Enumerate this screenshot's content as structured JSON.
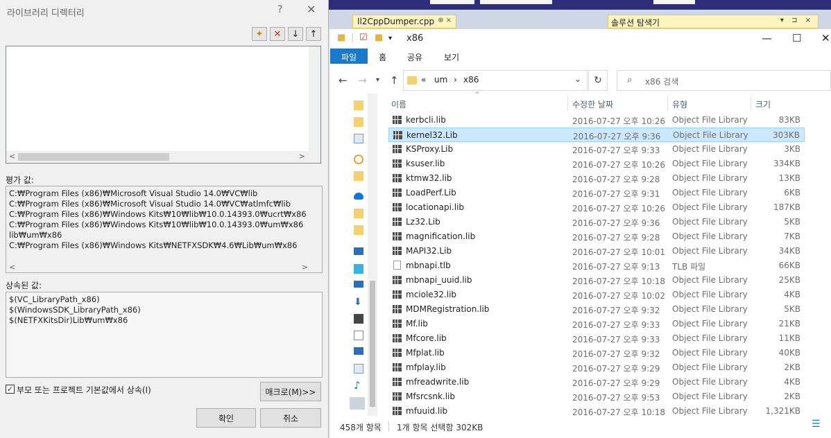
{
  "vs": {
    "tab_label": "Il2CppDumper.cpp",
    "tab_pin": "⊕ ×",
    "solution_label": "솔루션 탐색기",
    "solution_controls": "▾ ⊐ ×"
  },
  "dialog": {
    "title": "라이브러리 디렉터리",
    "help": "?",
    "close": "✕",
    "toolbar": {
      "new_line": "✦",
      "delete": "✕",
      "move_down": "↓",
      "move_up": "↑"
    },
    "scroll_left": "<",
    "scroll_right": ">",
    "evaluated_label": "평가 값:",
    "evaluated_lines": [
      "C:₩Program Files (x86)₩Microsoft Visual Studio 14.0₩VC₩lib",
      "C:₩Program Files (x86)₩Microsoft Visual Studio 14.0₩VC₩atlmfc₩lib",
      "C:₩Program Files (x86)₩Windows Kits₩10₩lib₩10.0.14393.0₩ucrt₩x86",
      "C:₩Program Files (x86)₩Windows Kits₩10₩lib₩10.0.14393.0₩um₩x86",
      "lib₩um₩x86",
      "C:₩Program Files (x86)₩Windows Kits₩NETFXSDK₩4.6₩Lib₩um₩x86"
    ],
    "inherited_label": "상속된 값:",
    "inherited_lines": [
      "$(VC_LibraryPath_x86)",
      "$(WindowsSDK_LibraryPath_x86)",
      "$(NETFXKitsDir)Lib₩um₩x86"
    ],
    "inherit_checkbox_label": "부모 또는 프로젝트 기본값에서 상속(I)",
    "inherit_checked": true,
    "macro_button": "매크로(M)>>",
    "ok_button": "확인",
    "cancel_button": "취소"
  },
  "explorer": {
    "title": "x86",
    "ribbon_tabs": [
      "파일",
      "홈",
      "공유",
      "보기"
    ],
    "breadcrumb": [
      "«",
      "um",
      "›",
      "x86"
    ],
    "search_placeholder": "x86 검색",
    "columns": {
      "name": "이름",
      "date": "수정한 날짜",
      "type": "유형",
      "size": "크기"
    },
    "files": [
      {
        "name": "kerbcli.lib",
        "date": "2016-07-27 오후 10:26",
        "type": "Object File Library",
        "size": "83KB",
        "icon": "lib"
      },
      {
        "name": "kernel32.Lib",
        "date": "2016-07-27 오후 9:36",
        "type": "Object File Library",
        "size": "303KB",
        "icon": "lib",
        "selected": true
      },
      {
        "name": "KSProxy.Lib",
        "date": "2016-07-27 오후 9:33",
        "type": "Object File Library",
        "size": "3KB",
        "icon": "lib"
      },
      {
        "name": "ksuser.lib",
        "date": "2016-07-27 오후 10:26",
        "type": "Object File Library",
        "size": "334KB",
        "icon": "lib"
      },
      {
        "name": "ktmw32.lib",
        "date": "2016-07-27 오후 9:28",
        "type": "Object File Library",
        "size": "13KB",
        "icon": "lib"
      },
      {
        "name": "LoadPerf.Lib",
        "date": "2016-07-27 오후 9:31",
        "type": "Object File Library",
        "size": "6KB",
        "icon": "lib"
      },
      {
        "name": "locationapi.lib",
        "date": "2016-07-27 오후 10:26",
        "type": "Object File Library",
        "size": "187KB",
        "icon": "lib"
      },
      {
        "name": "Lz32.Lib",
        "date": "2016-07-27 오후 9:36",
        "type": "Object File Library",
        "size": "5KB",
        "icon": "lib"
      },
      {
        "name": "magnification.lib",
        "date": "2016-07-27 오후 9:28",
        "type": "Object File Library",
        "size": "7KB",
        "icon": "lib"
      },
      {
        "name": "MAPI32.Lib",
        "date": "2016-07-27 오후 10:01",
        "type": "Object File Library",
        "size": "34KB",
        "icon": "lib"
      },
      {
        "name": "mbnapi.tlb",
        "date": "2016-07-27 오후 9:13",
        "type": "TLB 파일",
        "size": "66KB",
        "icon": "tlb"
      },
      {
        "name": "mbnapi_uuid.lib",
        "date": "2016-07-27 오후 10:18",
        "type": "Object File Library",
        "size": "25KB",
        "icon": "lib"
      },
      {
        "name": "mciole32.lib",
        "date": "2016-07-27 오후 10:02",
        "type": "Object File Library",
        "size": "4KB",
        "icon": "lib"
      },
      {
        "name": "MDMRegistration.lib",
        "date": "2016-07-27 오후 9:32",
        "type": "Object File Library",
        "size": "5KB",
        "icon": "lib"
      },
      {
        "name": "Mf.lib",
        "date": "2016-07-27 오후 9:33",
        "type": "Object File Library",
        "size": "21KB",
        "icon": "lib"
      },
      {
        "name": "Mfcore.lib",
        "date": "2016-07-27 오후 9:33",
        "type": "Object File Library",
        "size": "11KB",
        "icon": "lib"
      },
      {
        "name": "Mfplat.lib",
        "date": "2016-07-27 오후 9:32",
        "type": "Object File Library",
        "size": "40KB",
        "icon": "lib"
      },
      {
        "name": "mfplay.lib",
        "date": "2016-07-27 오후 9:29",
        "type": "Object File Library",
        "size": "2KB",
        "icon": "lib"
      },
      {
        "name": "mfreadwrite.lib",
        "date": "2016-07-27 오후 9:29",
        "type": "Object File Library",
        "size": "4KB",
        "icon": "lib"
      },
      {
        "name": "Mfsrcsnk.lib",
        "date": "2016-07-27 오후 9:53",
        "type": "Object File Library",
        "size": "2KB",
        "icon": "lib"
      },
      {
        "name": "mfuuid.lib",
        "date": "2016-07-27 오후 10:18",
        "type": "Object File Library",
        "size": "1,321KB",
        "icon": "lib"
      }
    ],
    "status_count": "458개 항목",
    "status_selection": "1개 항목 선택함 302KB",
    "colors": {
      "accent": "#1979ca",
      "selection": "#cce8ff",
      "folder": "#f5d06f"
    }
  }
}
